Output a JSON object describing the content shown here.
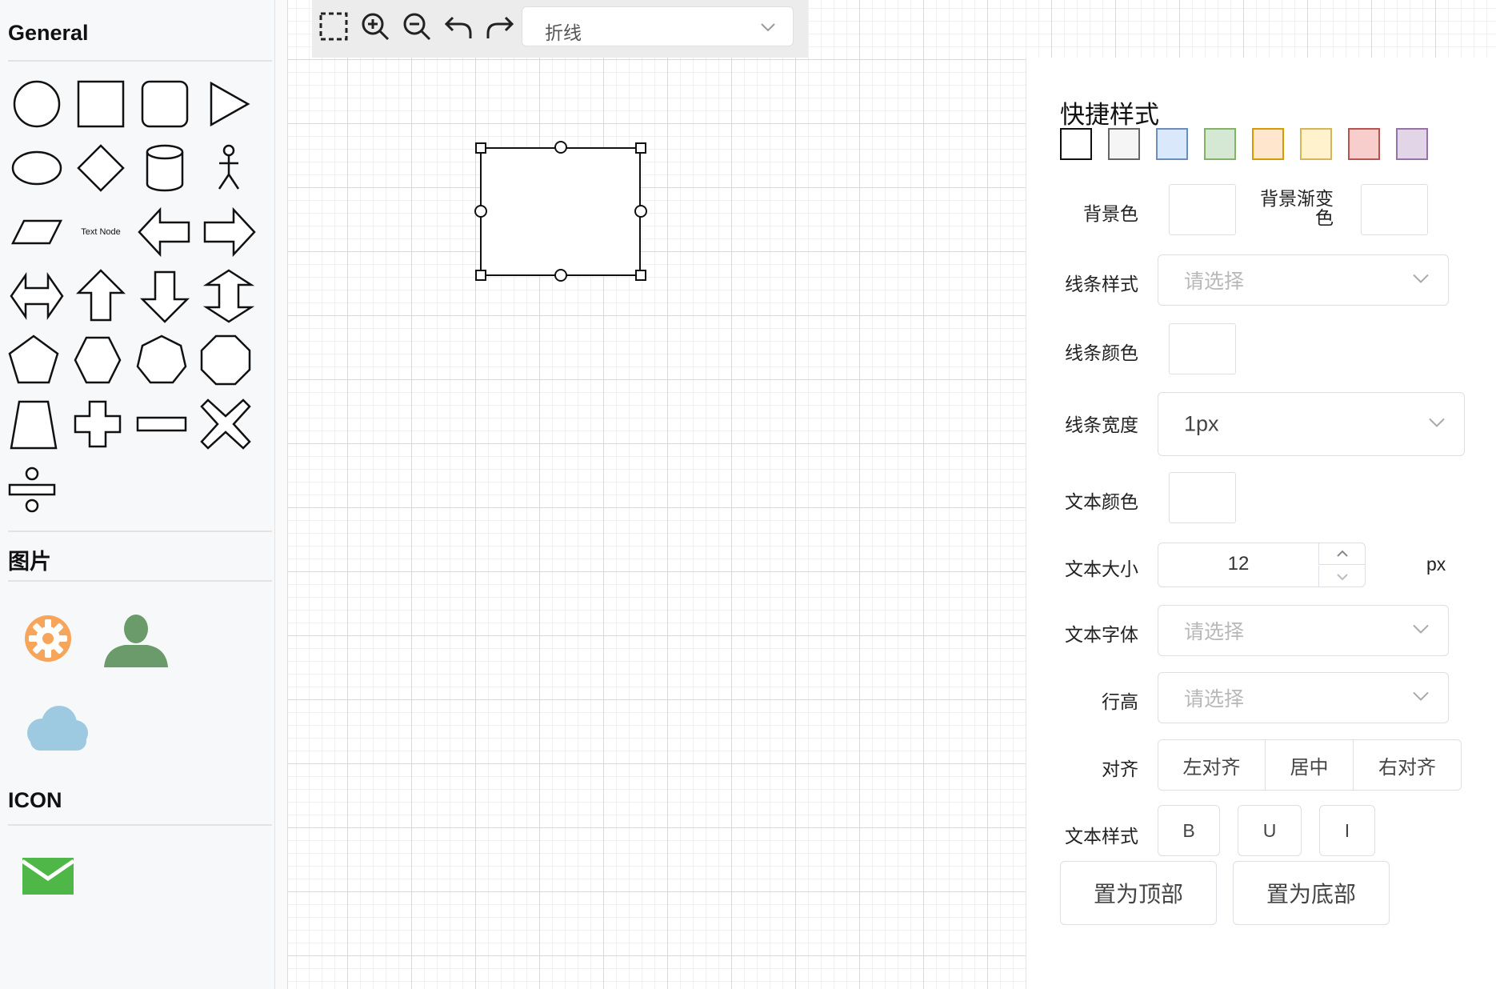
{
  "sidebar": {
    "sections": {
      "general": "General",
      "images": "图片",
      "icon": "ICON"
    },
    "text_node_label": "Text Node",
    "shapes": [
      "circle",
      "rectangle",
      "rounded-rectangle",
      "triangle",
      "ellipse",
      "rhombus",
      "cylinder",
      "actor",
      "parallelogram",
      "text-node",
      "arrow-left",
      "arrow-right",
      "arrow-left-right",
      "arrow-up",
      "arrow-down",
      "arrow-up-down",
      "pentagon",
      "hexagon",
      "heptagon",
      "octagon",
      "trapezoid",
      "cross",
      "minus",
      "times",
      "divide"
    ],
    "images": [
      "gear-icon",
      "user-icon",
      "cloud-icon"
    ],
    "icons": [
      "envelope-icon"
    ]
  },
  "toolbar": {
    "tools": [
      "selection-icon",
      "zoom-in-icon",
      "zoom-out-icon",
      "undo-icon",
      "redo-icon"
    ],
    "edge_type": "折线"
  },
  "panel": {
    "title": "快捷样式",
    "quick_styles": [
      {
        "fill": "#ffffff",
        "stroke": "#111111"
      },
      {
        "fill": "#f5f5f5",
        "stroke": "#666666"
      },
      {
        "fill": "#dae8fc",
        "stroke": "#6c8ebf"
      },
      {
        "fill": "#d5e8d4",
        "stroke": "#82b366"
      },
      {
        "fill": "#ffe6cc",
        "stroke": "#d79b00"
      },
      {
        "fill": "#fff2cc",
        "stroke": "#d6b656"
      },
      {
        "fill": "#f8cecc",
        "stroke": "#b85450"
      },
      {
        "fill": "#e1d5e7",
        "stroke": "#9673a6"
      }
    ],
    "labels": {
      "bg_color": "背景色",
      "bg_gradient": "背景渐变色",
      "line_style": "线条样式",
      "line_color": "线条颜色",
      "line_width": "线条宽度",
      "text_color": "文本颜色",
      "text_size": "文本大小",
      "text_font": "文本字体",
      "line_height": "行高",
      "align": "对齐",
      "text_style": "文本样式"
    },
    "placeholder": "请选择",
    "line_width_value": "1px",
    "font_size_value": "12",
    "font_size_unit": "px",
    "align_options": [
      "左对齐",
      "居中",
      "右对齐"
    ],
    "text_style_options": [
      "B",
      "U",
      "I"
    ],
    "bring_to_top": "置为顶部",
    "send_to_bottom": "置为底部"
  }
}
